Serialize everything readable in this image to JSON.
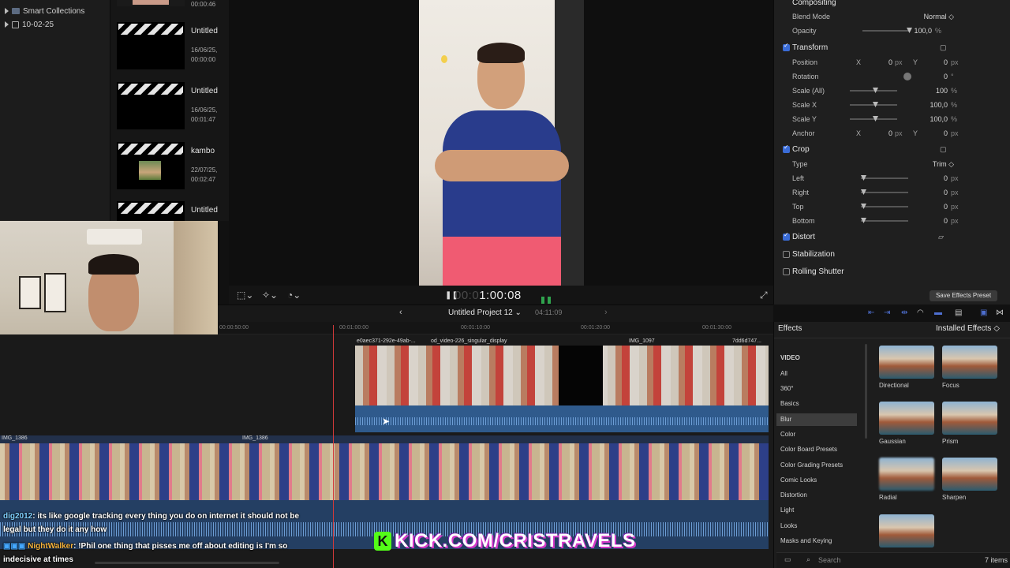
{
  "library": {
    "items": [
      {
        "label": "Smart Collections"
      },
      {
        "label": "10-02-25"
      }
    ]
  },
  "browser": {
    "clips": [
      {
        "name": "",
        "date": "00:00:46"
      },
      {
        "name": "Untitled",
        "date": "16/06/25,\n00:00:00"
      },
      {
        "name": "Untitled",
        "date": "16/06/25,\n00:01:47"
      },
      {
        "name": "kambo",
        "date": "22/07/25,\n00:02:47"
      },
      {
        "name": "Untitled",
        "date": ""
      }
    ]
  },
  "viewer": {
    "timecode_dim": "00:0",
    "timecode": "1:00:08"
  },
  "inspector": {
    "compositing": {
      "title": "Compositing",
      "blend_label": "Blend Mode",
      "blend_value": "Normal ◇",
      "opacity_label": "Opacity",
      "opacity_value": "100,0",
      "opacity_unit": "%"
    },
    "transform": {
      "title": "Transform",
      "position_label": "Position",
      "position_x": "0",
      "position_y": "0",
      "rotation_label": "Rotation",
      "rotation_value": "0",
      "rotation_unit": "°",
      "scale_all_label": "Scale (All)",
      "scale_all_value": "100",
      "scale_x_label": "Scale X",
      "scale_x_value": "100,0",
      "scale_y_label": "Scale Y",
      "scale_y_value": "100,0",
      "anchor_label": "Anchor",
      "anchor_x": "0",
      "anchor_y": "0"
    },
    "crop": {
      "title": "Crop",
      "type_label": "Type",
      "type_value": "Trim ◇",
      "left_label": "Left",
      "left_value": "0",
      "right_label": "Right",
      "right_value": "0",
      "top_label": "Top",
      "top_value": "0",
      "bottom_label": "Bottom",
      "bottom_value": "0"
    },
    "distort": {
      "title": "Distort"
    },
    "stabilization": {
      "title": "Stabilization"
    },
    "rolling_shutter": {
      "title": "Rolling Shutter"
    },
    "save_preset": "Save Effects Preset",
    "unit_px": "px",
    "unit_pct": "%",
    "x_lbl": "X",
    "y_lbl": "Y"
  },
  "timeline": {
    "project_name": "Untitled Project 12 ⌄",
    "duration": "04:11:09",
    "ruler": [
      "00:00:50:00",
      "00:01:00:00",
      "00:01:10:00",
      "00:01:20:00",
      "00:01:30:00"
    ],
    "upper_clips": [
      "e0aec371-292e-49ab-...",
      "od_video-226_singular_display",
      "IMG_1097",
      "7dd6d747..."
    ],
    "lower_clips": [
      "IMG_1386",
      "IMG_1386"
    ]
  },
  "effects": {
    "title": "Effects",
    "installed": "Installed Effects ◇",
    "categories": [
      "VIDEO",
      "All",
      "360°",
      "Basics",
      "Blur",
      "Color",
      "Color Board Presets",
      "Color Grading Presets",
      "Comic Looks",
      "Distortion",
      "Light",
      "Looks",
      "Masks and Keying"
    ],
    "selected_category": "Blur",
    "tiles": [
      "Directional",
      "Focus",
      "Gaussian",
      "Prism",
      "Radial",
      "Sharpen",
      ""
    ],
    "search_placeholder": "Search",
    "count": "7 items"
  },
  "chat": {
    "line1_user": "dig2012",
    "line1_text": ": its like google tracking every thing you do on internet it should not be",
    "line1_cont": "legal but they do it any how",
    "line2_user": "NightWalker",
    "line2_text": ": !Phil one thing that pisses me off about editing is I'm so",
    "line2_cont": "indecisive at times"
  },
  "overlay": {
    "kick_logo": "K",
    "kick_url": "KICK.COM/CRISTRAVELS"
  },
  "colors": {
    "accent_blue": "#3a6cd7",
    "playhead": "#d23a3a",
    "kick_green": "#53fc18"
  }
}
